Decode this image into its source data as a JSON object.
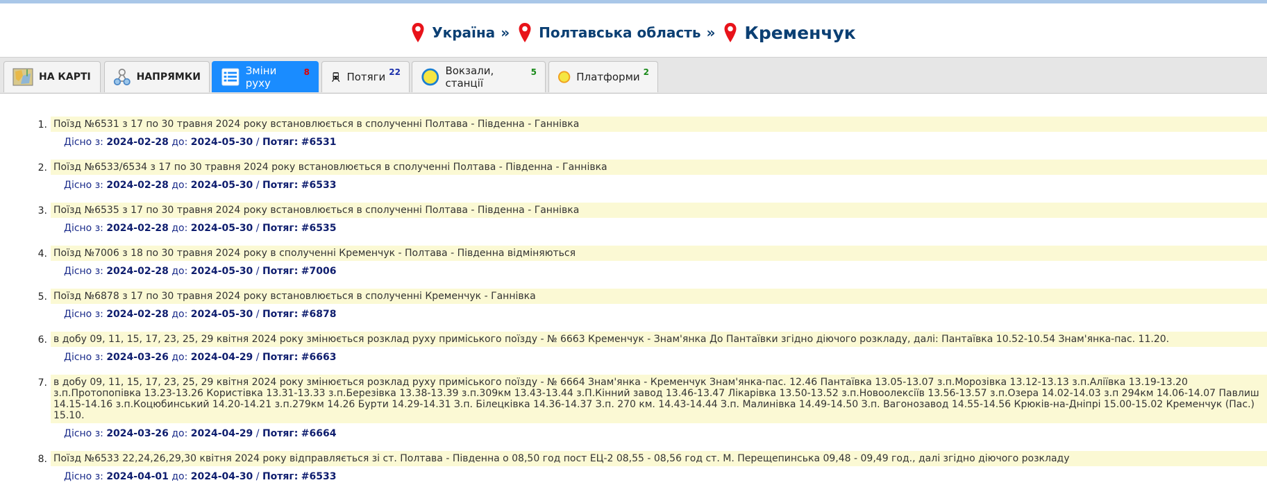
{
  "breadcrumb": {
    "items": [
      "Україна",
      "Полтавська область",
      "Кременчук"
    ],
    "separator": "»"
  },
  "tabs": [
    {
      "label": "НА КАРТІ",
      "count": ""
    },
    {
      "label": "НАПРЯМКИ",
      "count": ""
    },
    {
      "label": "Зміни руху",
      "count": "8"
    },
    {
      "label": "Потяги",
      "count": "22"
    },
    {
      "label": "Вокзали, станції",
      "count": "5"
    },
    {
      "label": "Платформи",
      "count": "2"
    }
  ],
  "labels": {
    "valid_from": "Дісно з:",
    "to": "до:",
    "train": "Потяг:"
  },
  "changes": [
    {
      "n": "1.",
      "text": "Поїзд №6531 з 17 по 30 травня 2024 року встановлюється в сполученні Полтава - Південна - Ганнівка",
      "from": "2024-02-28",
      "to": "2024-05-30",
      "train": "#6531"
    },
    {
      "n": "2.",
      "text": "Поїзд №6533/6534 з 17 по 30 травня 2024 року встановлюється в сполученні Полтава - Південна - Ганнівка",
      "from": "2024-02-28",
      "to": "2024-05-30",
      "train": "#6533"
    },
    {
      "n": "3.",
      "text": "Поїзд №6535 з 17 по 30 травня 2024 року встановлюється в сполученні Полтава - Південна - Ганнівка",
      "from": "2024-02-28",
      "to": "2024-05-30",
      "train": "#6535"
    },
    {
      "n": "4.",
      "text": "Поїзд №7006 з 18 по 30 травня 2024 року в сполученні Кременчук - Полтава - Південна відміняються",
      "from": "2024-02-28",
      "to": "2024-05-30",
      "train": "#7006"
    },
    {
      "n": "5.",
      "text": "Поїзд №6878 з 17 по 30 травня 2024 року встановлюється в сполученні Кременчук - Ганнівка",
      "from": "2024-02-28",
      "to": "2024-05-30",
      "train": "#6878"
    },
    {
      "n": "6.",
      "text": "в добу 09, 11, 15, 17, 23, 25, 29 квітня 2024 року змінюється розклад руху приміського поїзду - № 6663 Кременчук - Знам'янка До Пантаївки згідно діючого розкладу, далі: Пантаївка 10.52-10.54 Знам'янка-пас. 11.20.",
      "from": "2024-03-26",
      "to": "2024-04-29",
      "train": "#6663"
    },
    {
      "n": "7.",
      "text": "в добу 09, 11, 15, 17, 23, 25, 29 квітня 2024 року змінюється розклад руху приміського поїзду - № 6664 Знам'янка - Кременчук Знам'янка-пас. 12.46 Пантаївка 13.05-13.07 з.п.Морозівка 13.12-13.13 з.п.Аліївка 13.19-13.20 з.п.Протопопівка 13.23-13.26 Користівка 13.31-13.33 з.п.Березівка 13.38-13.39 з.п.309км 13.43-13.44 з.П.Кінний завод 13.46-13.47 Лікарівка 13.50-13.52 з.п.Новоолексіїв 13.56-13.57 з.п.Озера 14.02-14.03 з.п 294км 14.06-14.07 Павлиш 14.15-14.16 з.п.Коцюбинський 14.20-14.21 з.п.279км 14.26 Бурти 14.29-14.31 З.п. Білецківка 14.36-14.37 З.п. 270 км. 14.43-14.44 З.п. Малинівка 14.49-14.50 З.п. Вагонозавод 14.55-14.56 Крюків-на-Дніпрі 15.00-15.02 Кременчук (Пас.) 15.10.",
      "from": "2024-03-26",
      "to": "2024-04-29",
      "train": "#6664"
    },
    {
      "n": "8.",
      "text": "Поїзд №6533 22,24,26,29,30 квітня 2024 року відправляється зі ст. Полтава - Південна о 08,50 год пост ЕЦ-2 08,55 - 08,56 год ст. М. Перещепинська 09,48 - 09,49 год., далі згідно діючого розкладу",
      "from": "2024-04-01",
      "to": "2024-04-30",
      "train": "#6533"
    }
  ]
}
